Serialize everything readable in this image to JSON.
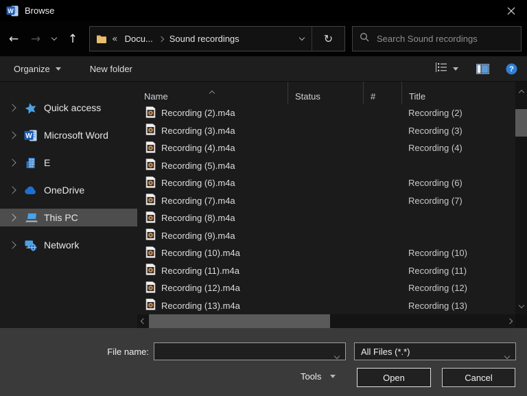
{
  "window": {
    "title": "Browse"
  },
  "nav": {
    "breadcrumb": {
      "overflow": "«",
      "root": "Docu...",
      "current": "Sound recordings"
    },
    "refresh_glyph": "↻",
    "back_glyph": "←",
    "forward_glyph": "→",
    "up_glyph": "↑",
    "search_placeholder": "Search Sound recordings"
  },
  "toolbar": {
    "organize_label": "Organize",
    "new_folder_label": "New folder"
  },
  "sidebar": {
    "items": [
      {
        "label": "Quick access",
        "icon": "star-icon",
        "selected": false
      },
      {
        "label": "Microsoft Word",
        "icon": "word-icon",
        "selected": false
      },
      {
        "label": "E",
        "icon": "building-icon",
        "selected": false
      },
      {
        "label": "OneDrive",
        "icon": "cloud-icon",
        "selected": false
      },
      {
        "label": "This PC",
        "icon": "laptop-icon",
        "selected": true
      },
      {
        "label": "Network",
        "icon": "network-icon",
        "selected": false
      }
    ]
  },
  "list": {
    "columns": {
      "name": "Name",
      "status": "Status",
      "number": "#",
      "title": "Title"
    },
    "sort": {
      "column": "Name",
      "direction": "ascending"
    },
    "rows": [
      {
        "name": "Recording (2).m4a",
        "status": "",
        "number": "",
        "title": "Recording (2)"
      },
      {
        "name": "Recording (3).m4a",
        "status": "",
        "number": "",
        "title": "Recording (3)"
      },
      {
        "name": "Recording (4).m4a",
        "status": "",
        "number": "",
        "title": "Recording (4)"
      },
      {
        "name": "Recording (5).m4a",
        "status": "",
        "number": "",
        "title": ""
      },
      {
        "name": "Recording (6).m4a",
        "status": "",
        "number": "",
        "title": "Recording (6)"
      },
      {
        "name": "Recording (7).m4a",
        "status": "",
        "number": "",
        "title": "Recording (7)"
      },
      {
        "name": "Recording (8).m4a",
        "status": "",
        "number": "",
        "title": ""
      },
      {
        "name": "Recording (9).m4a",
        "status": "",
        "number": "",
        "title": ""
      },
      {
        "name": "Recording (10).m4a",
        "status": "",
        "number": "",
        "title": "Recording (10)"
      },
      {
        "name": "Recording (11).m4a",
        "status": "",
        "number": "",
        "title": "Recording (11)"
      },
      {
        "name": "Recording (12).m4a",
        "status": "",
        "number": "",
        "title": "Recording (12)"
      },
      {
        "name": "Recording (13).m4a",
        "status": "",
        "number": "",
        "title": "Recording (13)"
      }
    ]
  },
  "footer": {
    "file_name_label": "File name:",
    "file_name_value": "",
    "file_type_value": "All Files (*.*)",
    "tools_label": "Tools",
    "open_label": "Open",
    "cancel_label": "Cancel"
  },
  "colors": {
    "accent_blue": "#2f7fd6",
    "word_blue": "#1e5bb8",
    "folder_yellow": "#e8c06d",
    "selection_gray": "#4d4d4d",
    "audio_icon_orange": "#cf8f4e",
    "footer_panel": "#3a3a3a"
  }
}
